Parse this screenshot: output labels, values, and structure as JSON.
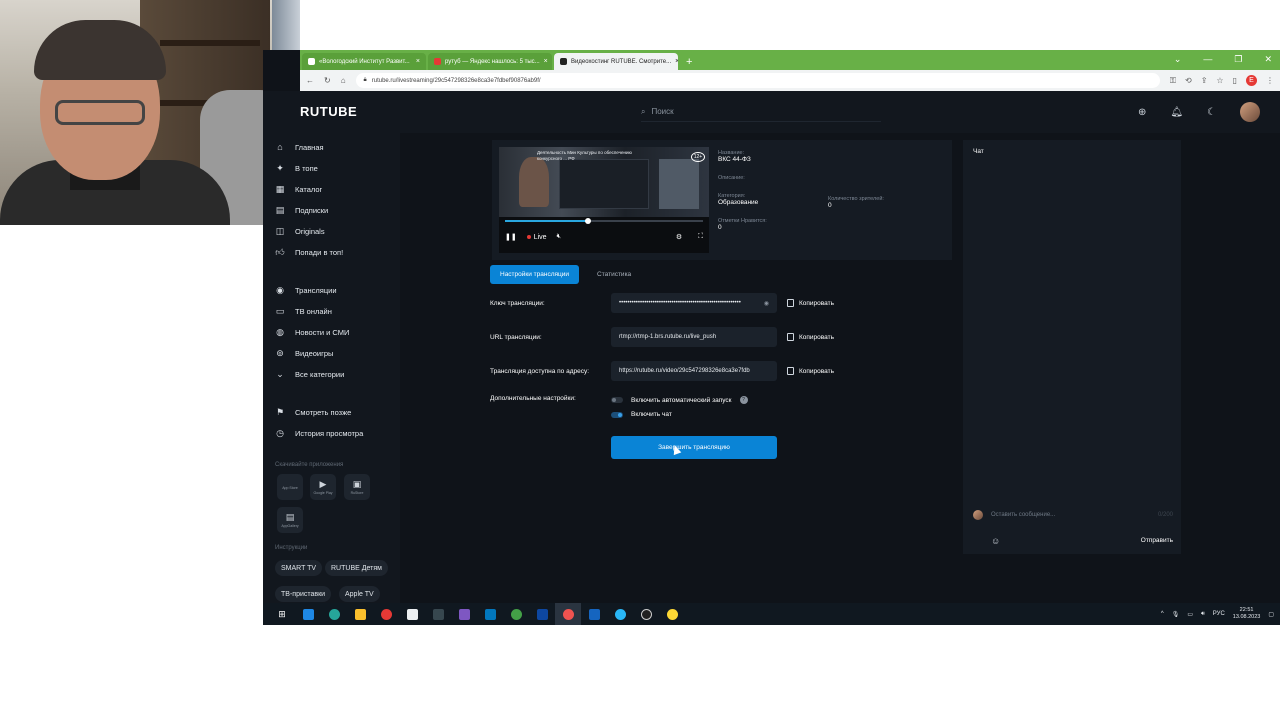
{
  "browser": {
    "tabs": [
      {
        "label": "«Вологодский Институт Развит...",
        "active": false
      },
      {
        "label": "рутуб — Яндекс нашлось: 5 тыс...",
        "active": false
      },
      {
        "label": "Видеохостинг RUTUBE. Смотрите...",
        "active": true
      }
    ],
    "new_tab": "+",
    "url": "rutube.ru/livestreaming/29c547298326e8ca3e7fdbef90876ab9f/",
    "profile_initial": "E"
  },
  "header": {
    "logo": "RUTUBE",
    "search_placeholder": "Поиск"
  },
  "sidebar": {
    "items": [
      {
        "label": "Главная",
        "icon": "home-icon"
      },
      {
        "label": "В топе",
        "icon": "flame-icon"
      },
      {
        "label": "Каталог",
        "icon": "grid-icon"
      },
      {
        "label": "Подписки",
        "icon": "subscriptions-icon"
      },
      {
        "label": "Originals",
        "icon": "originals-icon"
      },
      {
        "label": "Попади в топ!",
        "icon": "thumb-up-icon"
      }
    ],
    "items2": [
      {
        "label": "Трансляции",
        "icon": "broadcast-icon"
      },
      {
        "label": "ТВ онлайн",
        "icon": "tv-icon"
      },
      {
        "label": "Новости и СМИ",
        "icon": "globe-icon"
      },
      {
        "label": "Видеоигры",
        "icon": "gamepad-icon"
      },
      {
        "label": "Все категории",
        "icon": "chevron-down-icon"
      }
    ],
    "items3": [
      {
        "label": "Смотреть позже",
        "icon": "bookmark-icon"
      },
      {
        "label": "История просмотра",
        "icon": "history-icon"
      }
    ],
    "apps_title": "Скачивайте приложения",
    "apps": [
      {
        "label": "App Store",
        "icon": "apple-icon"
      },
      {
        "label": "Google Play",
        "icon": "play-store-icon"
      },
      {
        "label": "RuStore",
        "icon": "rustore-icon"
      },
      {
        "label": "AppGallery",
        "icon": "appgallery-icon"
      }
    ],
    "instructions_title": "Инструкции",
    "instructions": [
      "SMART TV",
      "RUTUBE Детям",
      "ТВ-приставки",
      "Apple TV"
    ]
  },
  "player": {
    "video_title": "Деятельность Мин Культуры по обеспечению конкурсного ... РФ",
    "age": "12+",
    "live_label": "Live",
    "progress": 0.42
  },
  "meta": {
    "name_label": "Название:",
    "name": "ВКС 44-ФЗ",
    "desc_label": "Описание:",
    "desc": "",
    "category_label": "Категория:",
    "category": "Образование",
    "likes_label": "Отметки Нравится:",
    "likes": "0",
    "viewers_label": "Количество зрителей:",
    "viewers": "0"
  },
  "tabs": {
    "settings": "Настройки трансляции",
    "stats": "Статистика"
  },
  "form": {
    "key_label": "Ключ трансляции:",
    "key_value": "••••••••••••••••••••••••••••••••••••••••••••••••••••••••••",
    "url_label": "URL трансляции:",
    "url_value": "rtmp://rtmp-1.brs.rutube.ru/live_push",
    "address_label": "Трансляция доступна по адресу:",
    "address_value": "https://rutube.ru/video/29c547298326e8ca3e7fdb",
    "copy_label": "Копировать",
    "extra_label": "Дополнительные настройки:",
    "autostart_label": "Включить автоматический запуск",
    "chat_label": "Включить чат",
    "finish_button": "Завершить трансляцию"
  },
  "chat": {
    "title": "Чат",
    "placeholder": "Оставить сообщение...",
    "counter": "0/200",
    "send": "Отправить"
  },
  "taskbar": {
    "lang": "РУС",
    "time": "22:51",
    "date": "13.08.2023"
  }
}
